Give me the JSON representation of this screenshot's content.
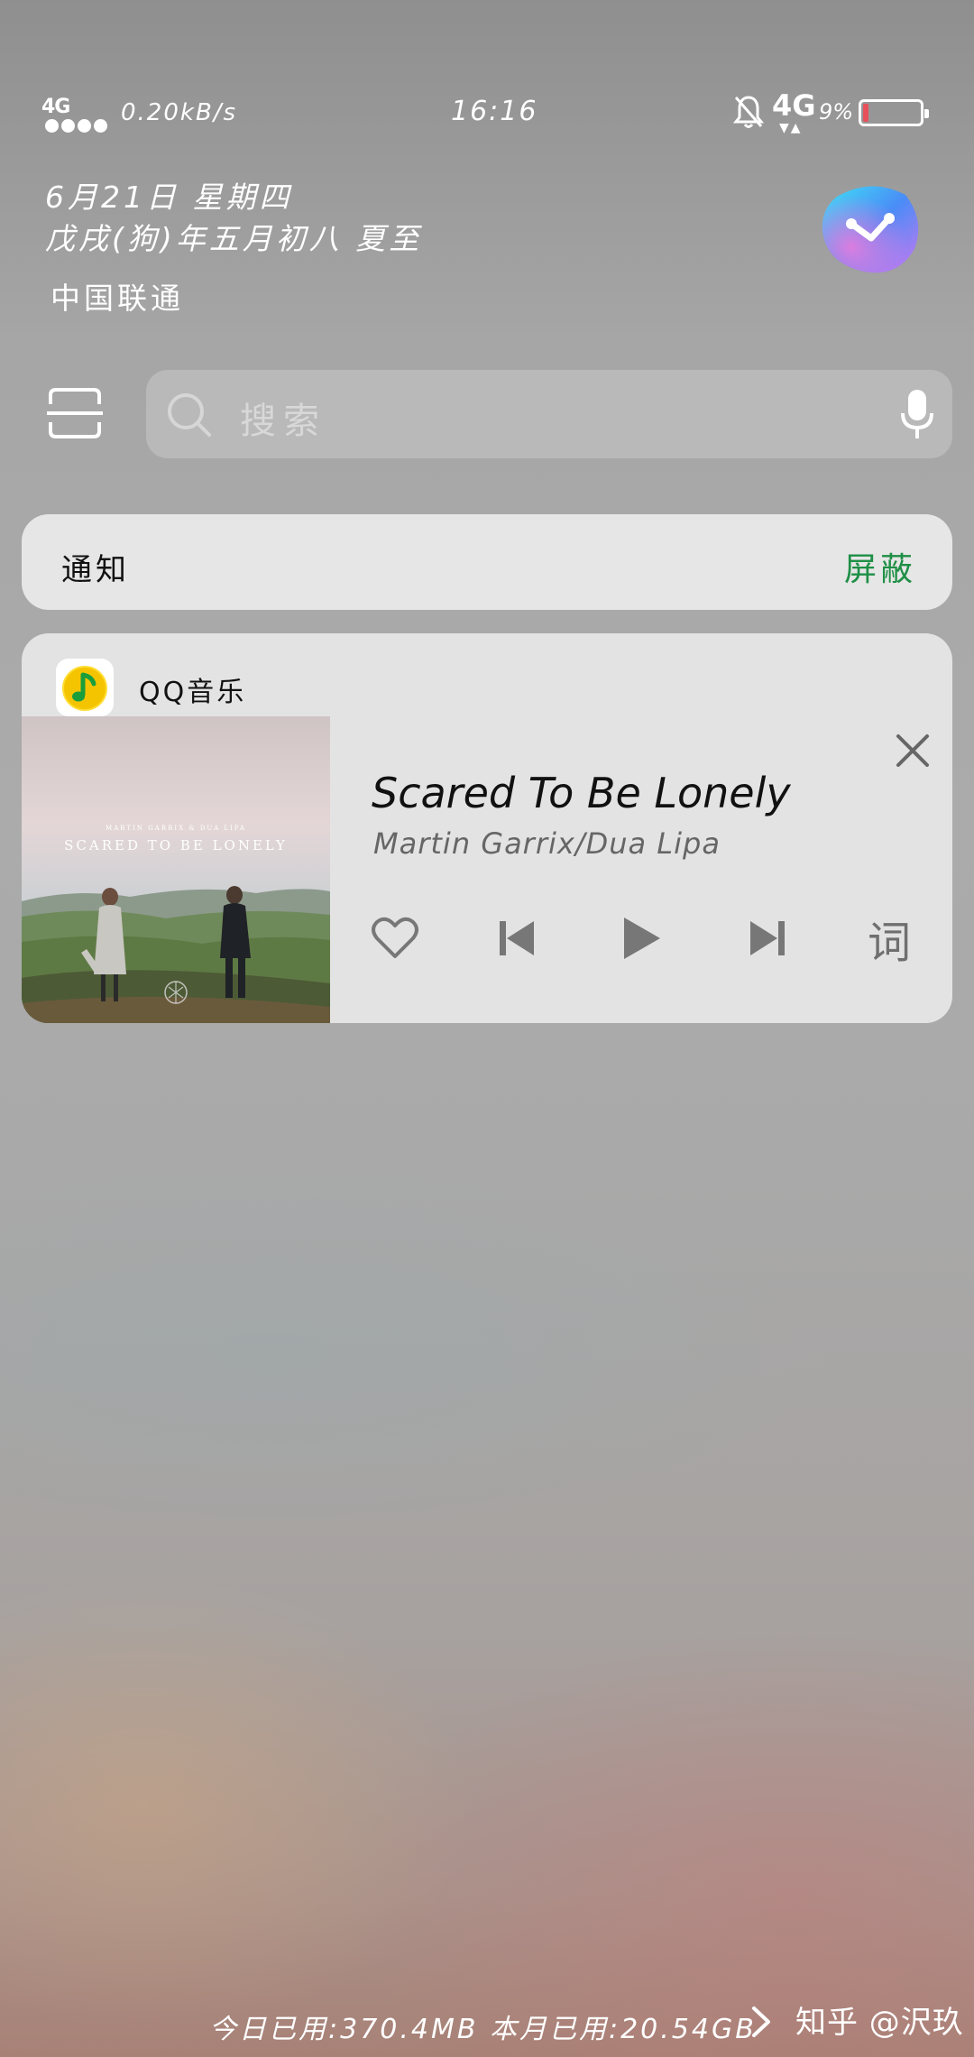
{
  "status_bar": {
    "network_left": "4G",
    "net_speed": "0.20kB/s",
    "time": "16:16",
    "network_right": "4G",
    "battery_percent_label": "9%",
    "battery_level": 0.09,
    "battery_color": "#e7505a"
  },
  "date": {
    "line1": "6月21日 星期四",
    "line2": "戊戌(狗)年五月初八 夏至",
    "carrier": "中国联通"
  },
  "search": {
    "placeholder": "搜索"
  },
  "notifications": {
    "title": "通知",
    "block_label": "屏蔽",
    "block_color": "#1e8f45"
  },
  "music": {
    "app_name": "QQ音乐",
    "song_title": "Scared To Be Lonely",
    "artist": "Martin Garrix/Dua Lipa",
    "album_art_text": "SCARED TO BE LONELY",
    "album_art_subtext": "MARTIN GARRIX & DUA LIPA",
    "lyrics_label": "词",
    "app_accent": "#f5c400"
  },
  "footer": {
    "data_usage": "今日已用:370.4MB 本月已用:20.54GB",
    "watermark": "知乎 @沢玖"
  }
}
